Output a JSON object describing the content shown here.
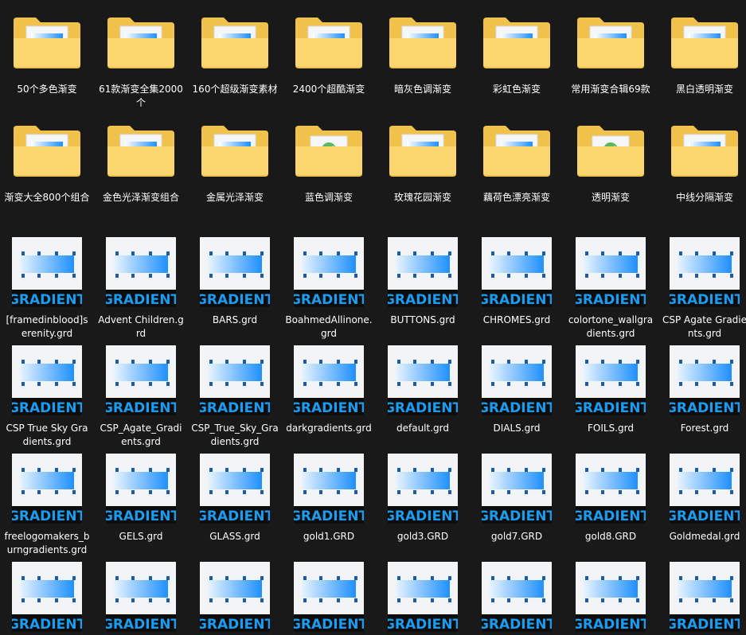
{
  "folders": [
    {
      "label": "50个多色渐变",
      "preview": "gradient"
    },
    {
      "label": "61款渐变全集2000个",
      "preview": "gradient"
    },
    {
      "label": "160个超级渐变素材",
      "preview": "gradient"
    },
    {
      "label": "2400个超酷渐变",
      "preview": "gradient"
    },
    {
      "label": "暗灰色调渐变",
      "preview": "gradient"
    },
    {
      "label": "彩虹色渐变",
      "preview": "gradient"
    },
    {
      "label": "常用渐变合辑69款",
      "preview": "gradient"
    },
    {
      "label": "黑白透明渐变",
      "preview": "gradient"
    },
    {
      "label": "渐变大全800个组合",
      "preview": "gradient"
    },
    {
      "label": "金色光泽渐变组合",
      "preview": "gradient"
    },
    {
      "label": "金属光泽渐变",
      "preview": "gradient"
    },
    {
      "label": "蓝色调渐变",
      "preview": "shell"
    },
    {
      "label": "玫瑰花园渐变",
      "preview": "gradient"
    },
    {
      "label": "藕荷色漂亮渐变",
      "preview": "gradient"
    },
    {
      "label": "透明渐变",
      "preview": "shell"
    },
    {
      "label": "中线分隔渐变",
      "preview": "gradient"
    }
  ],
  "files": [
    {
      "label": "[framedinblood]serenity.grd"
    },
    {
      "label": "Advent Children.grd"
    },
    {
      "label": "BARS.grd"
    },
    {
      "label": "BoahmedAllinone.grd"
    },
    {
      "label": "BUTTONS.grd"
    },
    {
      "label": "CHROMES.grd"
    },
    {
      "label": "colortone_wallgradients.grd"
    },
    {
      "label": "CSP Agate Gradients.grd"
    },
    {
      "label": "CSP True Sky Gradients.grd"
    },
    {
      "label": "CSP_Agate_Gradients.grd"
    },
    {
      "label": "CSP_True_Sky_Gradients.grd"
    },
    {
      "label": "darkgradients.grd"
    },
    {
      "label": "default.grd"
    },
    {
      "label": "DIALS.grd"
    },
    {
      "label": "FOILS.grd"
    },
    {
      "label": "Forest.grd"
    },
    {
      "label": "freelogomakers_burngradients.grd"
    },
    {
      "label": "GELS.grd"
    },
    {
      "label": "GLASS.grd"
    },
    {
      "label": "gold1.GRD"
    },
    {
      "label": "gold3.GRD"
    },
    {
      "label": "gold7.GRD"
    },
    {
      "label": "gold8.GRD"
    },
    {
      "label": "Goldmedal.grd"
    },
    {
      "label": ""
    },
    {
      "label": ""
    },
    {
      "label": ""
    },
    {
      "label": ""
    },
    {
      "label": ""
    },
    {
      "label": ""
    },
    {
      "label": ""
    },
    {
      "label": ""
    }
  ],
  "file_icon_text": "GRADIENT",
  "colors": {
    "background": "#191919",
    "folder_back": "#f0c14b",
    "folder_front": "#fbd56e",
    "gradient_blue": "#1e90ff",
    "badge_text": "#1a9cf0"
  }
}
